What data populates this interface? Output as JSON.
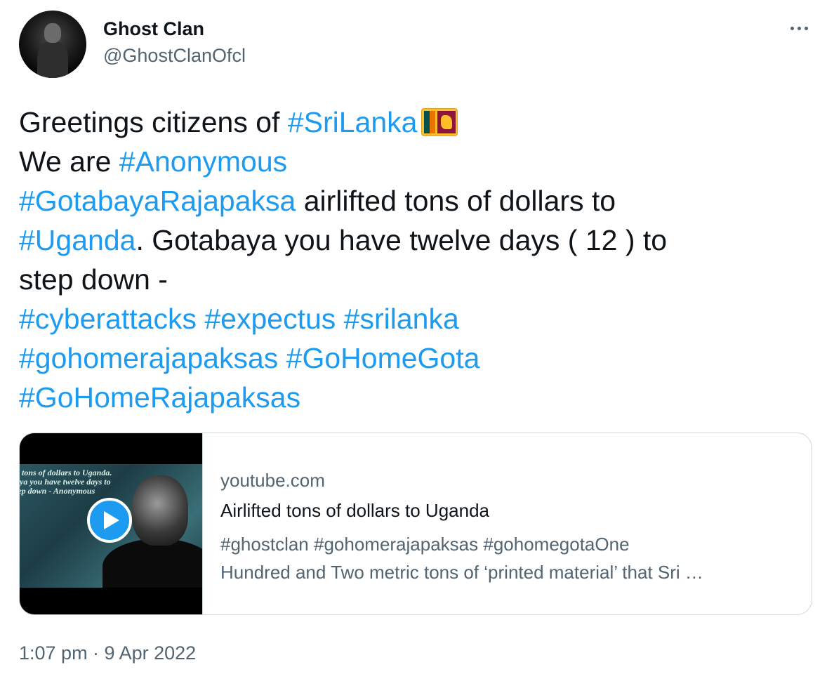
{
  "author": {
    "display_name": "Ghost Clan",
    "handle": "@GhostClanOfcl"
  },
  "tweet": {
    "line1": {
      "text_before": "Greetings citizens of ",
      "hashtag": "#SriLanka",
      "emoji": "sri-lanka-flag"
    },
    "line2": {
      "text_before": "We are ",
      "hashtag": "#Anonymous"
    },
    "line3": {
      "hashtag": "#GotabayaRajapaksa",
      "text_after": " airlifted tons of dollars to"
    },
    "line4": {
      "hashtag": "#Uganda",
      "text_after": ". Gotabaya you have twelve days ( 12 ) to"
    },
    "line5": {
      "text": "step down -"
    },
    "line6": {
      "tags": [
        "#cyberattacks",
        "#expectus",
        "#srilanka"
      ]
    },
    "line7": {
      "tags": [
        "#gohomerajapaksas",
        "#GoHomeGota"
      ]
    },
    "line8": {
      "tags": [
        "#GoHomeRajapaksas"
      ]
    }
  },
  "link_card": {
    "thumbnail_caption": [
      "d tons of dollars to Uganda.",
      "aya you have twelve days to",
      "tep down - Anonymous"
    ],
    "domain": "youtube.com",
    "title": "Airlifted tons of dollars to Uganda",
    "description_line1": "#ghostclan #gohomerajapaksas #gohomegotaOne",
    "description_line2": "Hundred and Two metric tons of ‘printed material’ that Sri …"
  },
  "timestamp": "1:07 pm · 9 Apr 2022",
  "colors": {
    "link": "#1d9bf0",
    "text": "#0f1419",
    "secondary": "#536471",
    "border": "#cfd9de"
  },
  "icons": [
    "more-options-icon",
    "play-icon",
    "sri-lanka-flag-emoji"
  ]
}
